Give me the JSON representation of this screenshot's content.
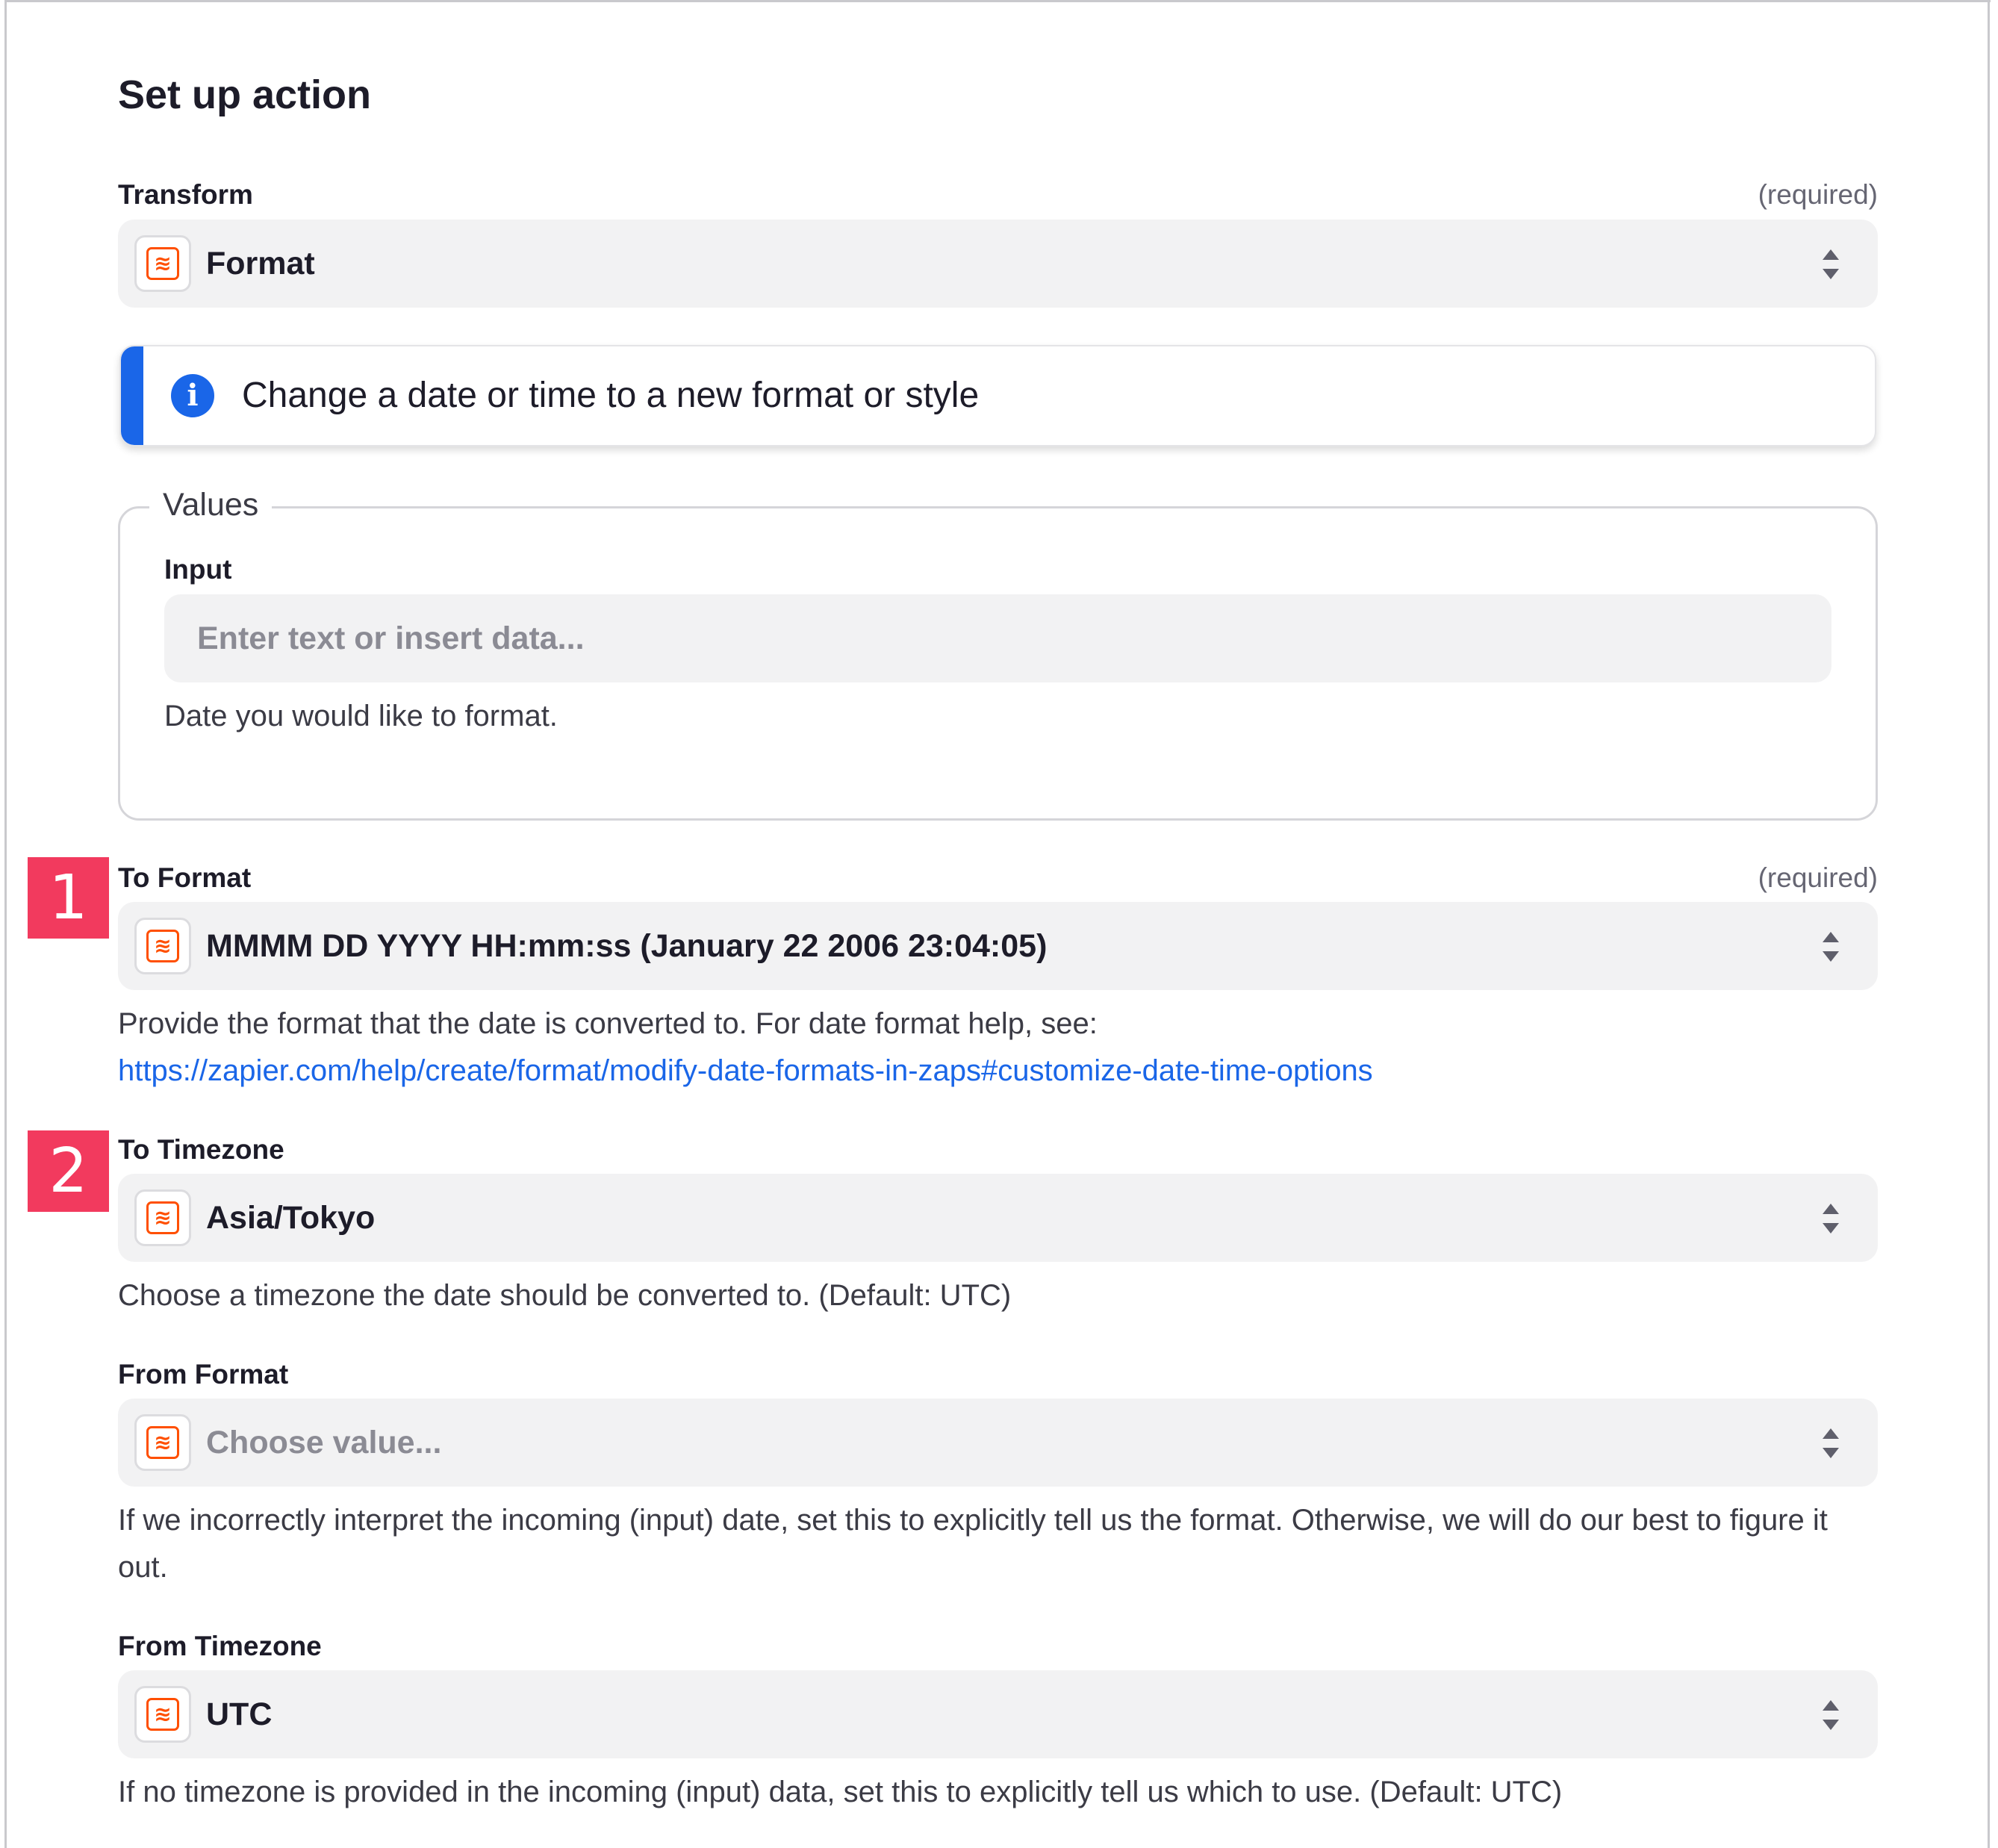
{
  "page": {
    "title": "Set up action"
  },
  "transform": {
    "label": "Transform",
    "required": "(required)",
    "value": "Format",
    "app_icon": "formatter-icon"
  },
  "info": {
    "text": "Change a date or time to a new format or style",
    "icon": "info-icon",
    "accent_color": "#1a66e8"
  },
  "values": {
    "legend": "Values",
    "input": {
      "label": "Input",
      "placeholder": "Enter text or insert data...",
      "help": "Date you would like to format."
    }
  },
  "to_format": {
    "badge": "1",
    "label": "To Format",
    "required": "(required)",
    "value": "MMMM DD YYYY HH:mm:ss (January 22 2006 23:04:05)",
    "help": "Provide the format that the date is converted to. For date format help, see:",
    "link": "https://zapier.com/help/create/format/modify-date-formats-in-zaps#customize-date-time-options"
  },
  "to_timezone": {
    "badge": "2",
    "label": "To Timezone",
    "value": "Asia/Tokyo",
    "help": "Choose a timezone the date should be converted to. (Default: UTC)"
  },
  "from_format": {
    "label": "From Format",
    "placeholder": "Choose value...",
    "help": "If we incorrectly interpret the incoming (input) date, set this to explicitly tell us the format. Otherwise, we will do our best to figure it out."
  },
  "from_timezone": {
    "label": "From Timezone",
    "value": "UTC",
    "help": "If no timezone is provided in the incoming (input) data, set this to explicitly tell us which to use. (Default: UTC)"
  },
  "colors": {
    "brand_orange": "#ff4f00",
    "badge_red": "#f23a5e",
    "link_blue": "#1a66e8"
  }
}
